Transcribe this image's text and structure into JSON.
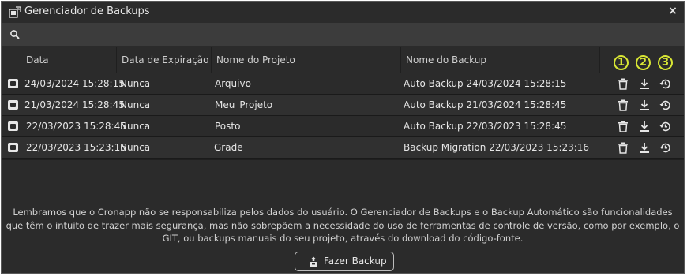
{
  "window": {
    "title": "Gerenciador de Backups",
    "close_label": "×"
  },
  "search": {
    "value": "",
    "placeholder": ""
  },
  "table": {
    "columns": [
      "Data",
      "Data de Expiração",
      "Nome do Projeto",
      "Nome do Backup"
    ],
    "action_markers": [
      "1",
      "2",
      "3"
    ],
    "rows": [
      {
        "date": "24/03/2024 15:28:15",
        "expiration": "Nunca",
        "project": "Arquivo",
        "backup": "Auto Backup 24/03/2024 15:28:15"
      },
      {
        "date": "21/03/2024 15:28:45",
        "expiration": "Nunca",
        "project": "Meu_Projeto",
        "backup": "Auto Backup 21/03/2024 15:28:45"
      },
      {
        "date": "22/03/2023 15:28:45",
        "expiration": "Nunca",
        "project": "Posto",
        "backup": "Auto Backup 22/03/2023 15:28:45"
      },
      {
        "date": "22/03/2023 15:23:16",
        "expiration": "Nunca",
        "project": "Grade",
        "backup": "Backup Migration 22/03/2023 15:23:16"
      }
    ]
  },
  "notice": "Lembramos que o Cronapp não se responsabiliza pelos dados do usuário. O Gerenciador de Backups e o Backup Automático são funcionalidades que têm o intuito de trazer mais segurança, mas não sobrepõem a necessidade do uso de ferramentas de controle de versão, como por exemplo, o GIT, ou backups manuais do seu projeto, através do download do código-fonte.",
  "actions": {
    "make_backup_label": "Fazer Backup"
  },
  "icons": {
    "title": "backup-manager-icon",
    "search": "search-icon",
    "row": "backup-file-icon",
    "delete": "trash-icon",
    "download": "download-icon",
    "restore": "restore-icon",
    "button": "backup-upload-icon"
  },
  "colors": {
    "background": "#2b2b2b",
    "search_bar": "#3c3c3c",
    "marker": "#d8e634",
    "text": "#e6e6e6"
  }
}
